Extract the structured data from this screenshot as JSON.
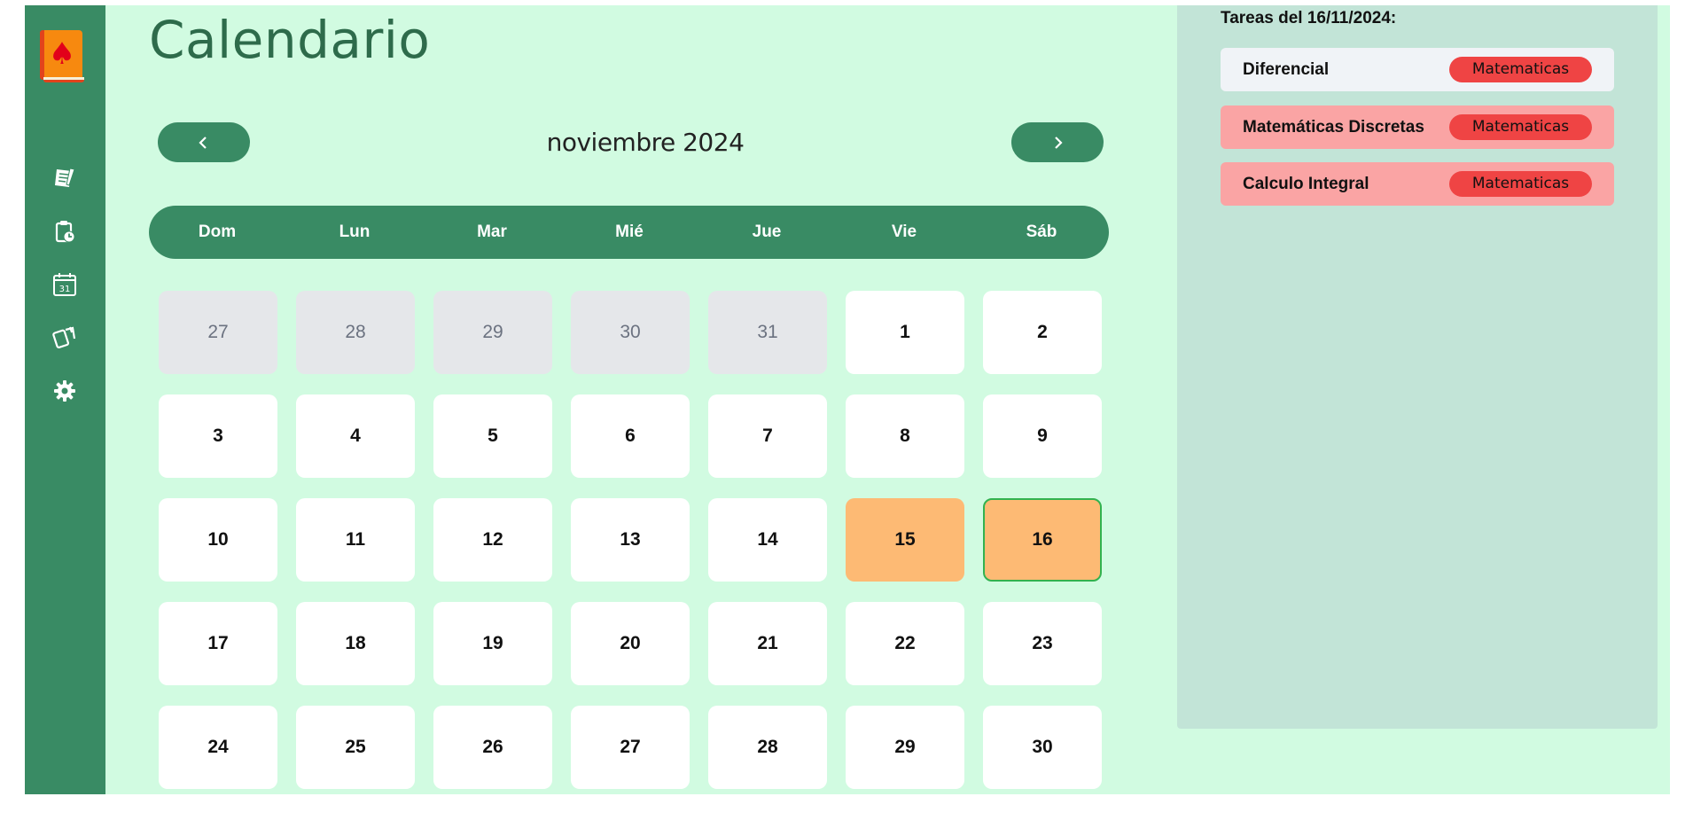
{
  "app": {
    "title": "Calendario"
  },
  "sidebar": {
    "items": [
      {
        "icon": "notes-icon",
        "name": "notes"
      },
      {
        "icon": "clipboard-clock-icon",
        "name": "pending-tasks"
      },
      {
        "icon": "calendar-icon",
        "name": "calendar",
        "calendar_number": "31"
      },
      {
        "icon": "cards-icon",
        "name": "flashcards"
      },
      {
        "icon": "gear-icon",
        "name": "settings"
      }
    ]
  },
  "calendar": {
    "month_label": "noviembre 2024",
    "prev_icon": "chevron-left-icon",
    "next_icon": "chevron-right-icon",
    "weekdays": [
      "Dom",
      "Lun",
      "Mar",
      "Mié",
      "Jue",
      "Vie",
      "Sáb"
    ],
    "weeks": [
      [
        {
          "n": "27",
          "other": true
        },
        {
          "n": "28",
          "other": true
        },
        {
          "n": "29",
          "other": true
        },
        {
          "n": "30",
          "other": true
        },
        {
          "n": "31",
          "other": true
        },
        {
          "n": "1"
        },
        {
          "n": "2"
        }
      ],
      [
        {
          "n": "3"
        },
        {
          "n": "4"
        },
        {
          "n": "5"
        },
        {
          "n": "6"
        },
        {
          "n": "7"
        },
        {
          "n": "8"
        },
        {
          "n": "9"
        }
      ],
      [
        {
          "n": "10"
        },
        {
          "n": "11"
        },
        {
          "n": "12"
        },
        {
          "n": "13"
        },
        {
          "n": "14"
        },
        {
          "n": "15",
          "has_task": true
        },
        {
          "n": "16",
          "has_task": true,
          "selected": true
        }
      ],
      [
        {
          "n": "17"
        },
        {
          "n": "18"
        },
        {
          "n": "19"
        },
        {
          "n": "20"
        },
        {
          "n": "21"
        },
        {
          "n": "22"
        },
        {
          "n": "23"
        }
      ],
      [
        {
          "n": "24"
        },
        {
          "n": "25"
        },
        {
          "n": "26"
        },
        {
          "n": "27"
        },
        {
          "n": "28"
        },
        {
          "n": "29"
        },
        {
          "n": "30"
        }
      ]
    ]
  },
  "tasks": {
    "title": "Tareas del 16/11/2024:",
    "items": [
      {
        "name": "Diferencial",
        "tag": "Matematicas",
        "status": "done"
      },
      {
        "name": "Matemáticas Discretas",
        "tag": "Matematicas",
        "status": "pending"
      },
      {
        "name": "Calculo Integral",
        "tag": "Matematicas",
        "status": "pending"
      }
    ]
  },
  "colors": {
    "sidebar": "#398b64",
    "background": "#d1fbe1",
    "panel": "#c2e4d7",
    "highlight_day": "#fdba74",
    "selected_border": "#32b24f",
    "tag": "#ef4444",
    "pending_task": "#faa4a4"
  }
}
